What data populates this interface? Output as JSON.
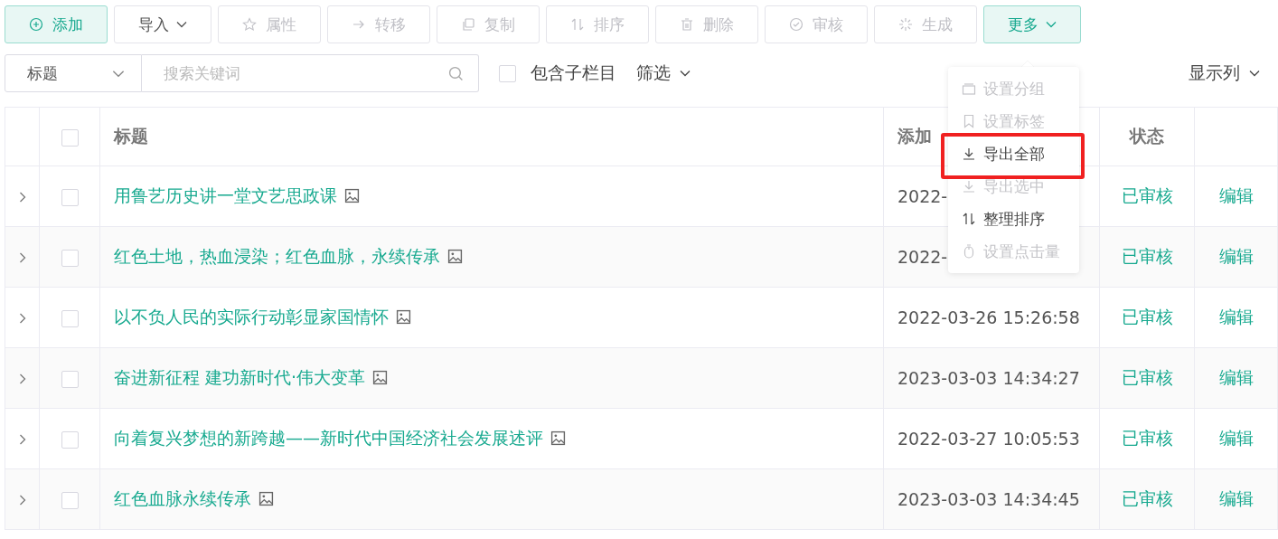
{
  "toolbar": [
    {
      "label": "添加",
      "kind": "primary",
      "disabled": false
    },
    {
      "label": "导入",
      "kind": "dropdown",
      "disabled": false
    },
    {
      "label": "属性",
      "kind": "plain",
      "disabled": true
    },
    {
      "label": "转移",
      "kind": "plain",
      "disabled": true
    },
    {
      "label": "复制",
      "kind": "plain",
      "disabled": true
    },
    {
      "label": "排序",
      "kind": "plain",
      "disabled": true
    },
    {
      "label": "删除",
      "kind": "plain",
      "disabled": true
    },
    {
      "label": "审核",
      "kind": "plain",
      "disabled": true
    },
    {
      "label": "生成",
      "kind": "plain",
      "disabled": true
    },
    {
      "label": "更多",
      "kind": "active",
      "disabled": false
    }
  ],
  "search": {
    "field_select": "标题",
    "placeholder": "搜索关键词",
    "include_sub": {
      "label": "包含子栏目",
      "checked": false
    },
    "filter": "筛选",
    "columns_toggle": "显示列"
  },
  "table": {
    "columns": [
      "标题",
      "添加",
      "状态"
    ],
    "select_all": {
      "checked": false
    },
    "rows": [
      {
        "title": "用鲁艺历史讲一堂文艺思政课",
        "date": "2022-",
        "status": "已审核",
        "action": "编辑",
        "checked": false
      },
      {
        "title": "红色土地，热血浸染；红色血脉，永续传承",
        "date": "2022-",
        "status": "已审核",
        "action": "编辑",
        "checked": false
      },
      {
        "title": "以不负人民的实际行动彰显家国情怀",
        "date": "2022-03-26 15:26:58",
        "status": "已审核",
        "action": "编辑",
        "checked": false
      },
      {
        "title": "奋进新征程 建功新时代·伟大变革",
        "date": "2023-03-03 14:34:27",
        "status": "已审核",
        "action": "编辑",
        "checked": false
      },
      {
        "title": "向着复兴梦想的新跨越——新时代中国经济社会发展述评",
        "date": "2022-03-27 10:05:53",
        "status": "已审核",
        "action": "编辑",
        "checked": false
      },
      {
        "title": "红色血脉永续传承",
        "date": "2023-03-03 14:34:45",
        "status": "已审核",
        "action": "编辑",
        "checked": false
      }
    ]
  },
  "more_menu": [
    {
      "label": "设置分组",
      "disabled": true,
      "highlighted": false
    },
    {
      "label": "设置标签",
      "disabled": true,
      "highlighted": false
    },
    {
      "label": "导出全部",
      "disabled": false,
      "highlighted": true
    },
    {
      "label": "导出选中",
      "disabled": true,
      "highlighted": false
    },
    {
      "label": "整理排序",
      "disabled": false,
      "highlighted": false
    },
    {
      "label": "设置点击量",
      "disabled": true,
      "highlighted": false
    }
  ]
}
